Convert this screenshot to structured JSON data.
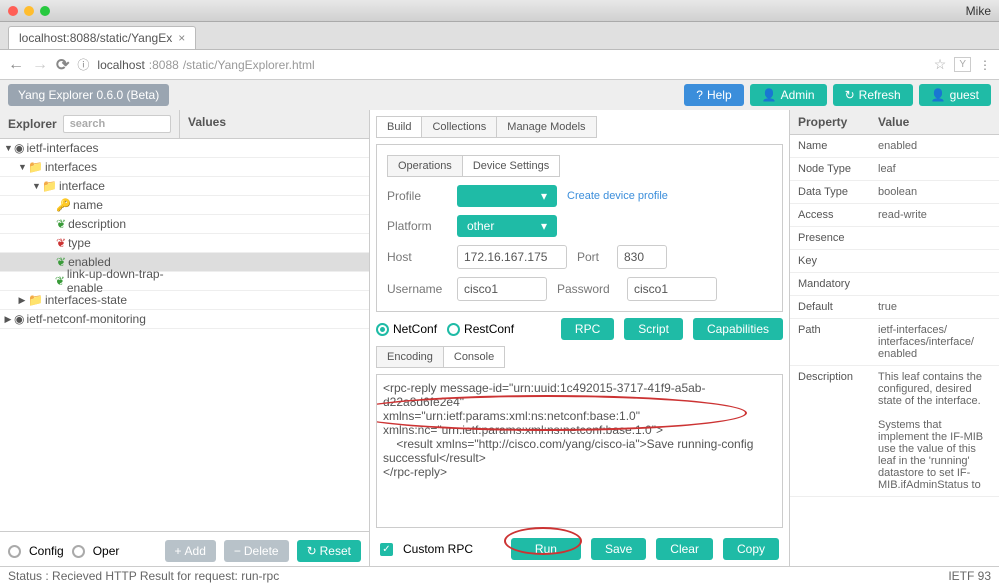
{
  "os": {
    "user": "Mike"
  },
  "browser": {
    "tab_title": "localhost:8088/static/YangEx",
    "url_host": "localhost",
    "url_port": ":8088",
    "url_path": "/static/YangExplorer.html"
  },
  "appbar": {
    "title": "Yang Explorer 0.6.0 (Beta)",
    "help": "Help",
    "admin": "Admin",
    "refresh": "Refresh",
    "guest": "guest"
  },
  "left": {
    "explorer": "Explorer",
    "search_ph": "search",
    "values": "Values",
    "tree": [
      {
        "ind": 0,
        "arrow": "▼",
        "icon": "pin",
        "label": "ietf-interfaces"
      },
      {
        "ind": 1,
        "arrow": "▼",
        "icon": "fold",
        "label": "interfaces"
      },
      {
        "ind": 2,
        "arrow": "▼",
        "icon": "fold",
        "label": "interface"
      },
      {
        "ind": 3,
        "arrow": "",
        "icon": "key",
        "label": "name"
      },
      {
        "ind": 3,
        "arrow": "",
        "icon": "leaf",
        "label": "description"
      },
      {
        "ind": 3,
        "arrow": "",
        "icon": "leafr",
        "label": "type"
      },
      {
        "ind": 3,
        "arrow": "",
        "icon": "leaf",
        "label": "enabled",
        "sel": true
      },
      {
        "ind": 3,
        "arrow": "",
        "icon": "leaf",
        "label": "link-up-down-trap-enable"
      },
      {
        "ind": 1,
        "arrow": "▶",
        "icon": "fold",
        "label": "interfaces-state"
      },
      {
        "ind": 0,
        "arrow": "▶",
        "icon": "pin",
        "label": "ietf-netconf-monitoring"
      }
    ],
    "config": "Config",
    "oper": "Oper",
    "add": "Add",
    "delete": "Delete",
    "reset": "Reset"
  },
  "mid": {
    "tabs1": [
      "Build",
      "Collections",
      "Manage Models"
    ],
    "tabs2": [
      "Operations",
      "Device Settings"
    ],
    "profile": "Profile",
    "platform": "Platform",
    "platform_val": "other",
    "create_link": "Create device profile",
    "host": "Host",
    "host_val": "172.16.167.175",
    "port": "Port",
    "port_val": "830",
    "user": "Username",
    "user_val": "cisco1",
    "pass": "Password",
    "pass_val": "cisco1",
    "netconf": "NetConf",
    "restconf": "RestConf",
    "rpc": "RPC",
    "script": "Script",
    "caps": "Capabilities",
    "tabs3": [
      "Encoding",
      "Console"
    ],
    "console": "<rpc-reply message-id=\"urn:uuid:1c492015-3717-41f9-a5ab-d22a8d6fe2e4\"\nxmlns=\"urn:ietf:params:xml:ns:netconf:base:1.0\"\nxmlns:nc=\"urn:ietf:params:xml:ns:netconf:base:1.0\">\n    <result xmlns=\"http://cisco.com/yang/cisco-ia\">Save running-config\nsuccessful</result>\n</rpc-reply>",
    "custom": "Custom RPC",
    "run": "Run",
    "save": "Save",
    "clear": "Clear",
    "copy": "Copy"
  },
  "right": {
    "hprop": "Property",
    "hval": "Value",
    "rows": [
      [
        "Name",
        "enabled"
      ],
      [
        "Node Type",
        "leaf"
      ],
      [
        "Data Type",
        "boolean"
      ],
      [
        "Access",
        "read-write"
      ],
      [
        "Presence",
        ""
      ],
      [
        "Key",
        ""
      ],
      [
        "Mandatory",
        ""
      ],
      [
        "Default",
        "true"
      ],
      [
        "Path",
        "ietf-interfaces/ interfaces/interface/ enabled"
      ],
      [
        "Description",
        "This leaf contains the configured, desired state of the interface.\n\nSystems that implement the IF-MIB use the value of this leaf in the 'running' datastore to set IF-MIB.ifAdminStatus to"
      ]
    ]
  },
  "status": {
    "left": "Status : Recieved HTTP Result for request: run-rpc",
    "right": "IETF 93"
  }
}
